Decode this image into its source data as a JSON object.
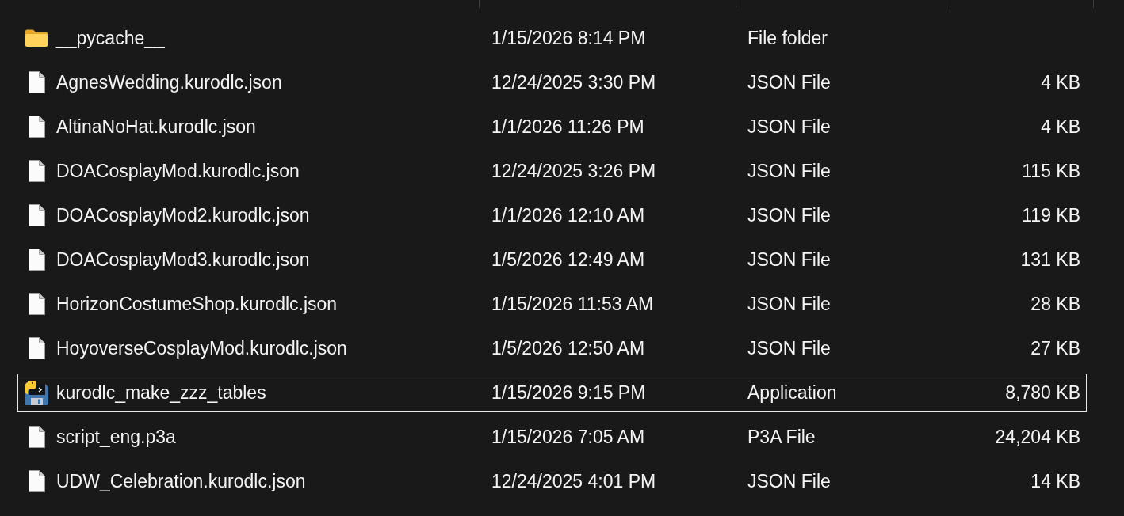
{
  "files": [
    {
      "kind": "folder",
      "name": "__pycache__",
      "date": "1/15/2026 8:14 PM",
      "type": "File folder",
      "focused": false,
      "selected": false
    },
    {
      "kind": "file",
      "name": "AgnesWedding.kurodlc.json",
      "date": "12/24/2025 3:30 PM",
      "type": "JSON File",
      "size": "4 KB",
      "focused": false,
      "selected": false
    },
    {
      "kind": "file",
      "name": "AltinaNoHat.kurodlc.json",
      "date": "1/1/2026 11:26 PM",
      "type": "JSON File",
      "size": "4 KB",
      "focused": false,
      "selected": false
    },
    {
      "kind": "file",
      "name": "DOACosplayMod.kurodlc.json",
      "date": "12/24/2025 3:26 PM",
      "type": "JSON File",
      "size": "115 KB",
      "focused": false,
      "selected": false
    },
    {
      "kind": "file",
      "name": "DOACosplayMod2.kurodlc.json",
      "date": "1/1/2026 12:10 AM",
      "type": "JSON File",
      "size": "119 KB",
      "focused": false,
      "selected": false
    },
    {
      "kind": "file",
      "name": "DOACosplayMod3.kurodlc.json",
      "date": "1/5/2026 12:49 AM",
      "type": "JSON File",
      "size": "131 KB",
      "focused": false,
      "selected": false
    },
    {
      "kind": "file",
      "name": "HorizonCostumeShop.kurodlc.json",
      "date": "1/15/2026 11:53 AM",
      "type": "JSON File",
      "size": "28 KB",
      "focused": false,
      "selected": false
    },
    {
      "kind": "file",
      "name": "HoyoverseCosplayMod.kurodlc.json",
      "date": "1/5/2026 12:50 AM",
      "type": "JSON File",
      "size": "27 KB",
      "focused": false,
      "selected": false
    },
    {
      "kind": "app",
      "name": "kurodlc_make_zzz_tables",
      "date": "1/15/2026 9:15 PM",
      "type": "Application",
      "size": "8,780 KB",
      "focused": true,
      "selected": false
    },
    {
      "kind": "file",
      "name": "script_eng.p3a",
      "date": "1/15/2026 7:05 AM",
      "type": "P3A File",
      "size": "24,204 KB",
      "focused": false,
      "selected": false
    },
    {
      "kind": "file",
      "name": "UDW_Celebration.kurodlc.json",
      "date": "12/24/2025 4:01 PM",
      "type": "JSON File",
      "size": "14 KB",
      "focused": false,
      "selected": false
    }
  ]
}
